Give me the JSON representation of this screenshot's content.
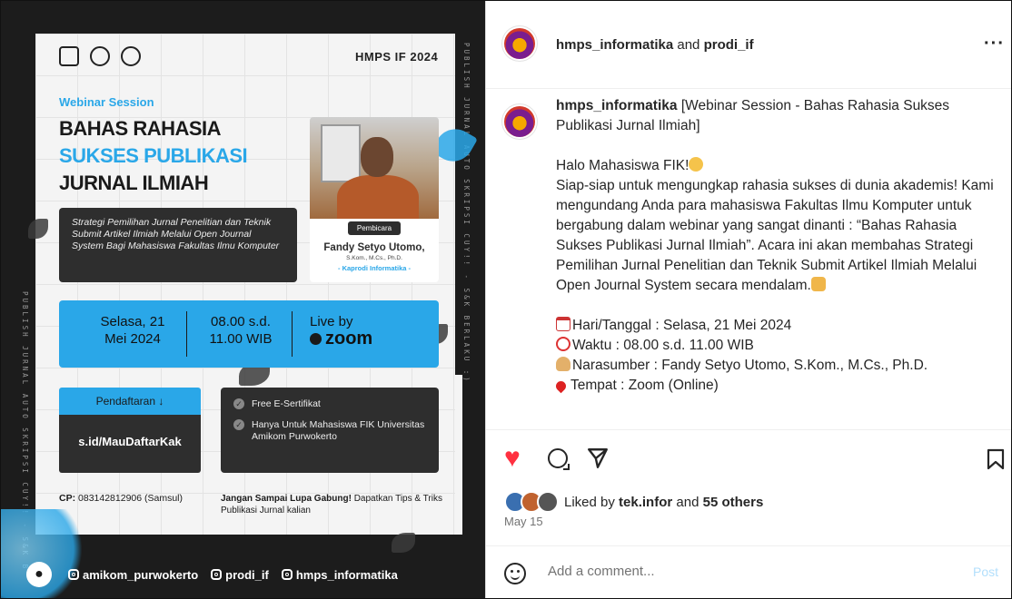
{
  "poster": {
    "org_tag": "HMPS IF 2024",
    "session_label": "Webinar Session",
    "headline_1": "BAHAS RAHASIA",
    "headline_2": "SUKSES PUBLIKASI",
    "headline_3": "JURNAL ILMIAH",
    "subtitle": "Strategi Pemilihan Jurnal Penelitian dan Teknik Submit Artikel Ilmiah Melalui Open Journal System Bagi Mahasiswa Fakultas Ilmu Komputer",
    "speaker_badge": "Pembicara",
    "speaker_name": "Fandy Setyo Utomo,",
    "speaker_degree": "S.Kom., M.Cs., Ph.D.",
    "speaker_role": "- Kaprodi Informatika -",
    "day": "Selasa, 21",
    "date": "Mei 2024",
    "time_start": "08.00 s.d.",
    "time_end": "11.00 WIB",
    "live_by": "Live by",
    "platform": "zoom",
    "registration_label": "Pendaftaran",
    "registration_link": "s.id/MauDaftarKak",
    "benefit_1": "Free E-Sertifikat",
    "benefit_2": "Hanya Untuk Mahasiswa FIK Universitas Amikom Purwokerto",
    "cp_label": "CP:",
    "cp_value": "083142812906 (Samsul)",
    "gabung_bold": "Jangan Sampai Lupa Gabung!",
    "gabung_rest": "Dapatkan Tips & Triks Publikasi Jurnal kalian",
    "side_text_right": "PUBLISH JURNAL AUTO SKRIPSI CUY!! - S&K BERLAKU :)",
    "side_text_left": "PUBLISH JURNAL AUTO SKRIPSI CUY!! - S&K B",
    "social_1": "amikom_purwokerto",
    "social_2": "prodi_if",
    "social_3": "hmps_informatika"
  },
  "header": {
    "account_1": "hmps_informatika",
    "joiner": "and",
    "account_2": "prodi_if",
    "more": "···"
  },
  "caption": {
    "username": "hmps_informatika",
    "title": "[Webinar Session - Bahas Rahasia Sukses Publikasi Jurnal Ilmiah]",
    "greeting": "Halo Mahasiswa FIK!",
    "body": "Siap-siap untuk mengungkap rahasia sukses di dunia akademis! Kami mengundang Anda para mahasiswa Fakultas Ilmu Komputer untuk bergabung dalam webinar yang sangat dinanti : “Bahas Rahasia Sukses Publikasi Jurnal Ilmiah”. Acara ini akan membahas Strategi Pemilihan Jurnal Penelitian dan Teknik Submit Artikel Ilmiah Melalui Open Journal System secara mendalam.",
    "info_date": "Hari/Tanggal : Selasa, 21 Mei 2024",
    "info_time": "Waktu : 08.00 s.d. 11.00 WIB",
    "info_speaker": "Narasumber : Fandy Setyo Utomo, S.Kom., M.Cs., Ph.D.",
    "info_place": "Tempat : Zoom (Online)"
  },
  "likes": {
    "prefix": "Liked by",
    "user": "tek.infor",
    "joiner": "and",
    "others": "55 others"
  },
  "date": "May 15",
  "comment": {
    "placeholder": "Add a comment...",
    "post_label": "Post"
  },
  "colors": {
    "accent_blue": "#2aa7e8",
    "like_red": "#ff3040",
    "post_disabled": "#b2dffc"
  }
}
